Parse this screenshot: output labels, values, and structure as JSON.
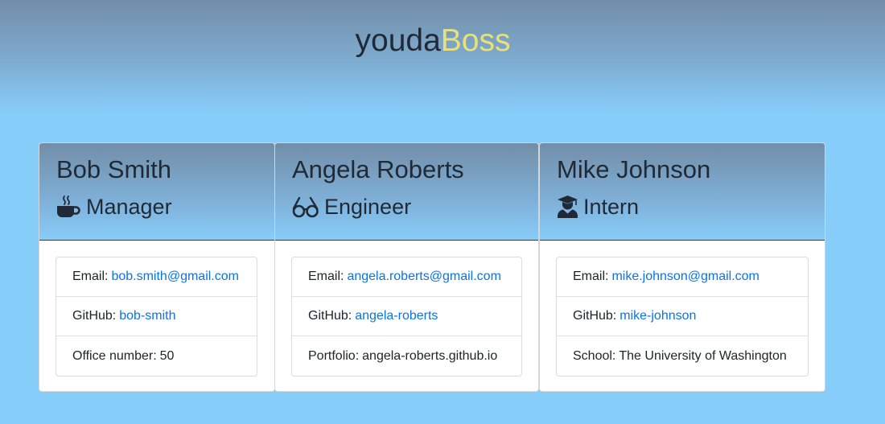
{
  "brand": {
    "part1": "youda",
    "part2": "Boss"
  },
  "colors": {
    "accent": "#e9e07d",
    "link": "#0a74e6",
    "background": "#87cdf9"
  },
  "cards": [
    {
      "name": "Bob Smith",
      "role": "Manager",
      "icon": "coffee-mug-icon",
      "email_label": "Email:",
      "email": "bob.smith@gmail.com",
      "github_label": "GitHub:",
      "github": "bob-smith",
      "extra_label": "Office number:",
      "extra": "50"
    },
    {
      "name": "Angela Roberts",
      "role": "Engineer",
      "icon": "glasses-icon",
      "email_label": "Email:",
      "email": "angela.roberts@gmail.com",
      "github_label": "GitHub:",
      "github": "angela-roberts",
      "extra_label": "Portfolio:",
      "extra": "angela-roberts.github.io"
    },
    {
      "name": "Mike Johnson",
      "role": "Intern",
      "icon": "graduate-icon",
      "email_label": "Email:",
      "email": "mike.johnson@gmail.com",
      "github_label": "GitHub:",
      "github": "mike-johnson",
      "extra_label": "School:",
      "extra": "The University of Washington"
    }
  ]
}
